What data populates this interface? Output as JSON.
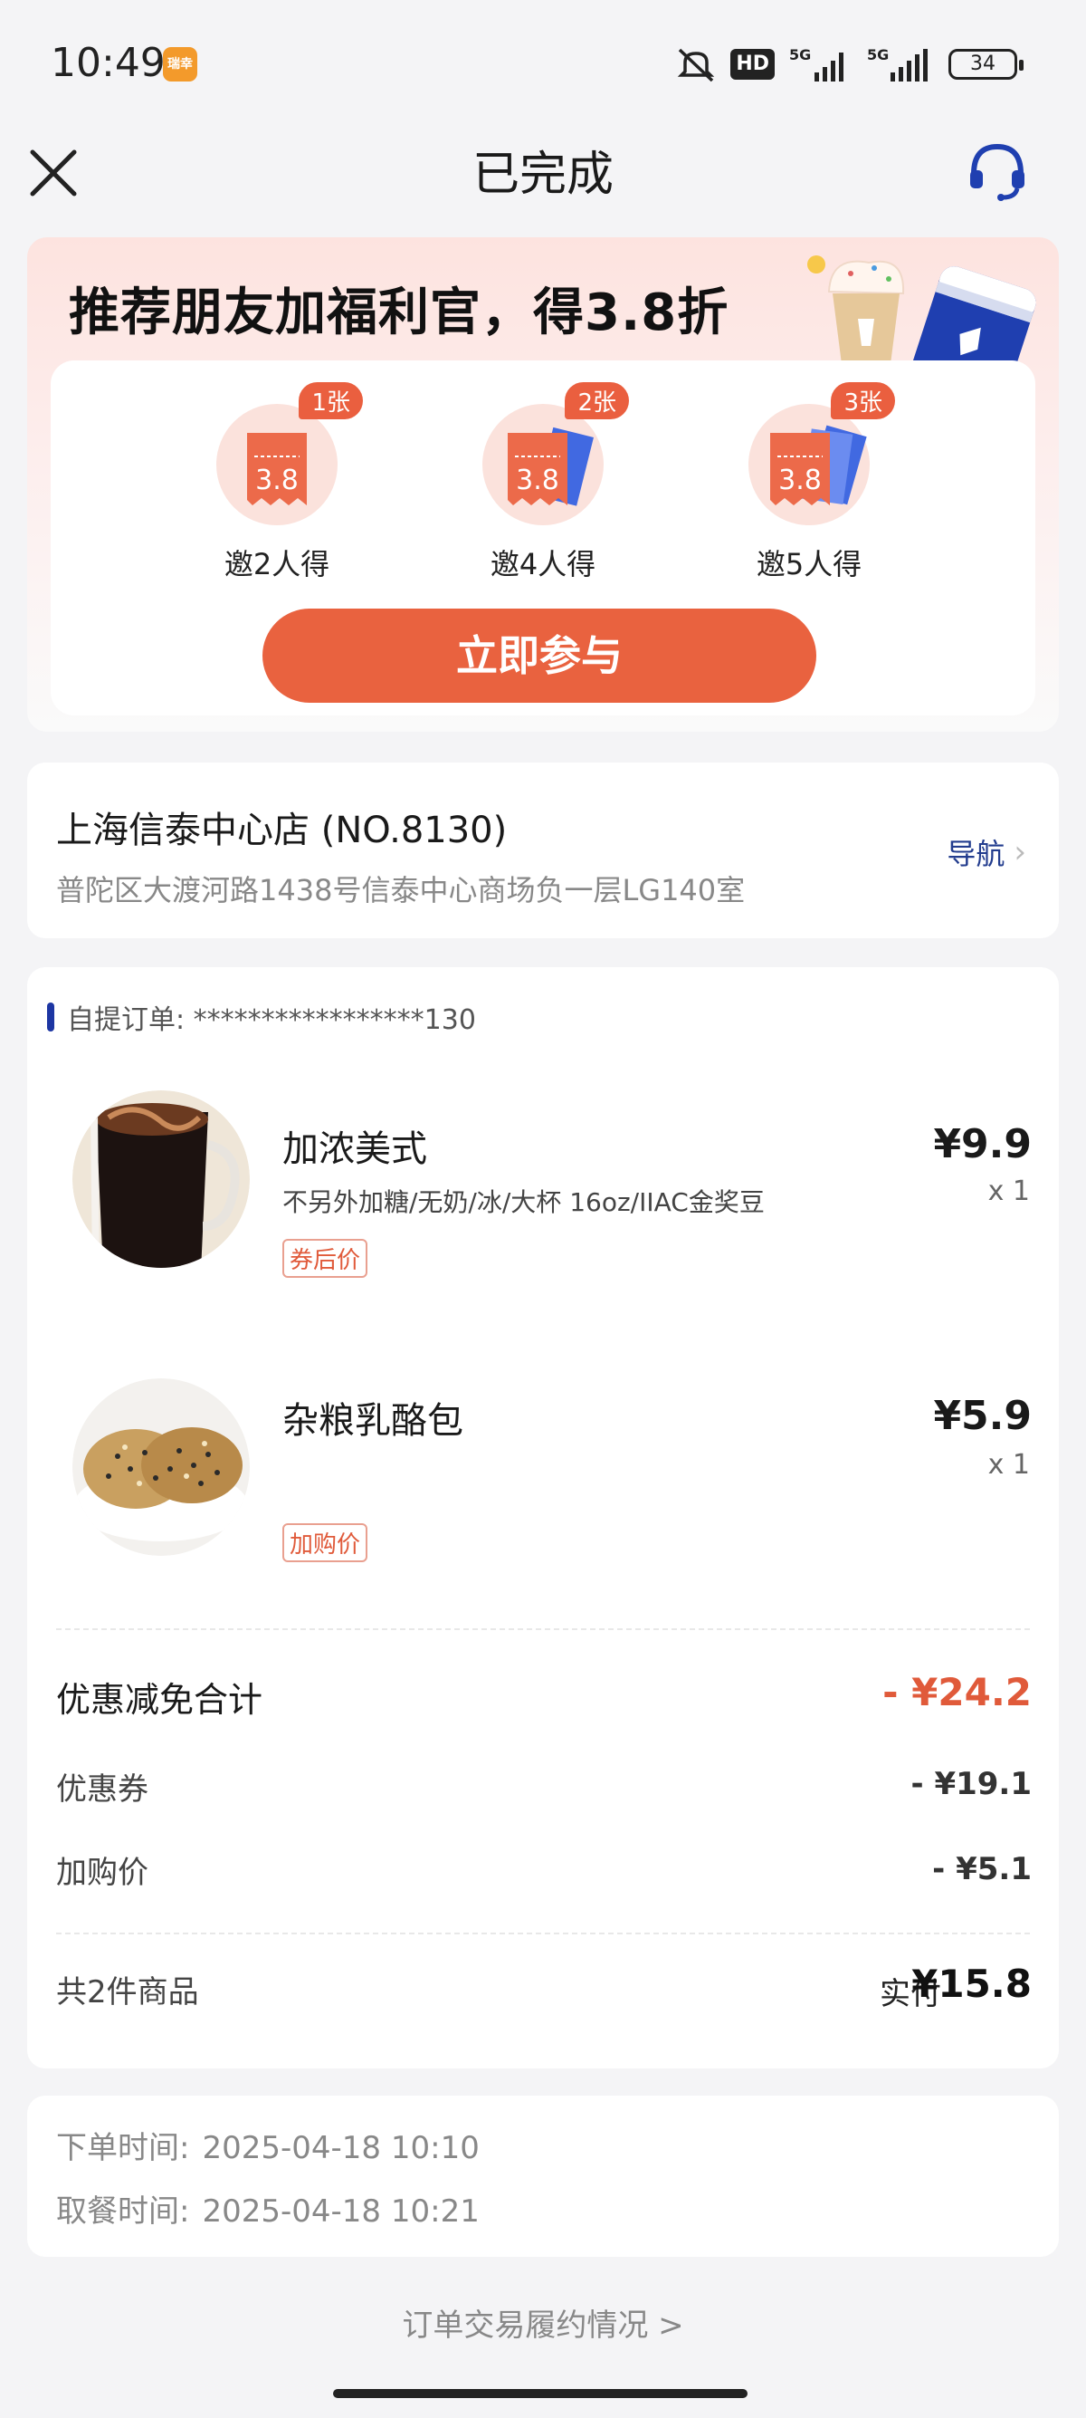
{
  "status_bar": {
    "time": "10:49",
    "app_badge": "瑞幸",
    "network_hd": "HD",
    "network_1": "5G",
    "network_2": "5G",
    "battery": "34"
  },
  "nav": {
    "title": "已完成"
  },
  "promo": {
    "title": "推荐朋友加福利官，得3.8折",
    "coupon_value": "3.8",
    "tiers": [
      {
        "badge": "1张",
        "label": "邀2人得"
      },
      {
        "badge": "2张",
        "label": "邀4人得"
      },
      {
        "badge": "3张",
        "label": "邀5人得"
      }
    ],
    "join_label": "立即参与",
    "accent": "#e9623f"
  },
  "store": {
    "name": "上海信泰中心店 (NO.8130)",
    "address": "普陀区大渡河路1438号信泰中心商场负一层LG140室",
    "nav_label": "导航",
    "nav_color": "#223c8e"
  },
  "order": {
    "header": "自提订单: *****************130",
    "items": [
      {
        "name": "加浓美式",
        "spec": "不另外加糖/无奶/冰/大杯 16oz/IIAC金奖豆",
        "tag": "券后价",
        "price": "¥9.9",
        "qty": "x 1"
      },
      {
        "name": "杂粮乳酪包",
        "spec": "",
        "tag": "加购价",
        "price": "¥5.9",
        "qty": "x 1"
      }
    ],
    "discount_total_label": "优惠减免合计",
    "discount_total_value": "- ¥24.2",
    "coupon_label": "优惠券",
    "coupon_value": "- ¥19.1",
    "addon_label": "加购价",
    "addon_value": "- ¥5.1",
    "count_label": "共2件商品",
    "paid_label": "实付",
    "paid_value": "¥15.8"
  },
  "times": {
    "order_time_label": "下单时间:",
    "order_time": "2025-04-18 10:10",
    "pickup_time_label": "取餐时间:",
    "pickup_time": "2025-04-18 10:21"
  },
  "footer": {
    "link": "订单交易履约情况 >"
  }
}
